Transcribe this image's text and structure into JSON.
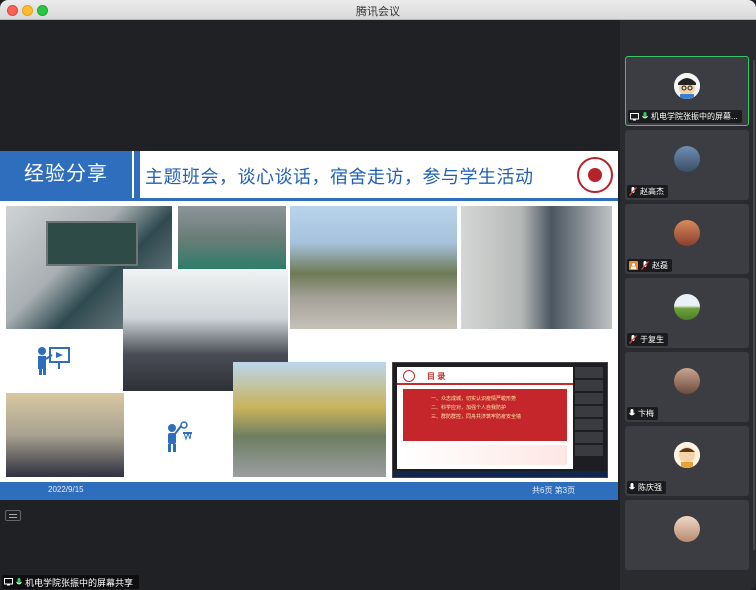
{
  "window": {
    "title": "腾讯会议"
  },
  "slide": {
    "section": "经验分享",
    "title": "主题班会，谈心谈话，宿舍走访，参与学生活动",
    "date": "2022/9/15",
    "pages": "共6页 第3页",
    "inset": {
      "toc_title": "目 录",
      "lines": [
        "一、众志成城，切实认识疫情严峻形势",
        "二、科学应对，加强个人自我防护",
        "三、群防群控，同舟共济筑牢防疫安全墙"
      ]
    }
  },
  "share": {
    "label": "机电学院张振中的屏幕共享"
  },
  "participants": [
    {
      "name": "机电学院张振中的屏幕...",
      "mic": "on",
      "sharing": true,
      "avatar": "cartoon-boy",
      "color": "#3a7fd0"
    },
    {
      "name": "赵高杰",
      "mic": "off",
      "avatar": "sky-photo",
      "color": "#7a8fa8"
    },
    {
      "name": "赵磊",
      "mic": "off",
      "video_off": true,
      "avatar": "warm-photo",
      "color": "#c76b4a"
    },
    {
      "name": "于复生",
      "mic": "off",
      "avatar": "field-photo",
      "color": "#7aa43a"
    },
    {
      "name": "卞梅",
      "mic": "on",
      "avatar": "person-photo",
      "color": "#b08a7a"
    },
    {
      "name": "陈庆强",
      "mic": "on",
      "avatar": "cartoon-child",
      "color": "#e8a23a"
    },
    {
      "name": "",
      "mic": "",
      "avatar": "girl-photo",
      "color": "#d8b8a0"
    }
  ],
  "colors": {
    "accent": "#2f6dbd",
    "active_border": "#3bc56a",
    "mic_on": "#3bc56a",
    "mic_off": "#e64545"
  }
}
